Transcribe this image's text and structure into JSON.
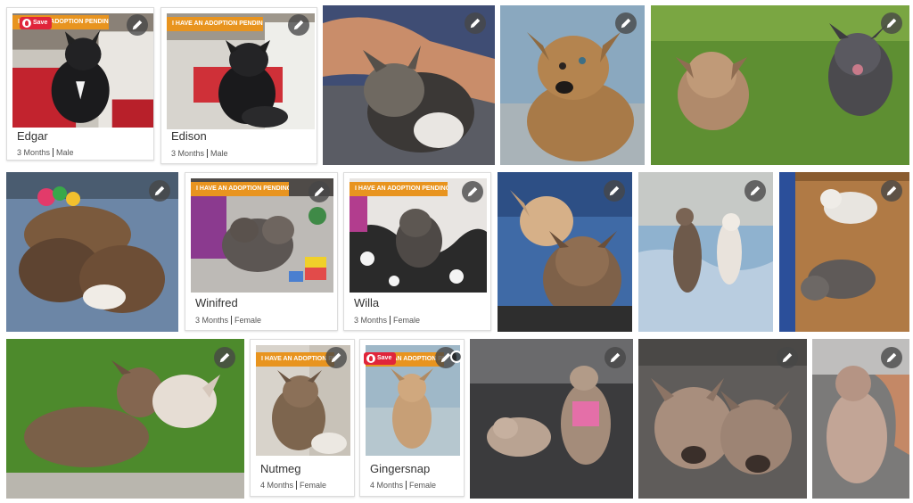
{
  "cards": [
    {
      "id": "edgar",
      "name": "Edgar",
      "age": "3 Months",
      "sex": "Male",
      "ribbon": "I HAVE AN ADOPTION PENDING"
    },
    {
      "id": "edison",
      "name": "Edison",
      "age": "3 Months",
      "sex": "Male",
      "ribbon": "I HAVE AN ADOPTION PENDING"
    },
    {
      "id": "winifred",
      "name": "Winifred",
      "age": "3 Months",
      "sex": "Female",
      "ribbon": "I HAVE AN ADOPTION PENDING"
    },
    {
      "id": "willa",
      "name": "Willa",
      "age": "3 Months",
      "sex": "Female",
      "ribbon": "I HAVE AN ADOPTION PENDING"
    },
    {
      "id": "nutmeg",
      "name": "Nutmeg",
      "age": "4 Months",
      "sex": "Female",
      "ribbon": "I HAVE AN ADOPTION PENDING"
    },
    {
      "id": "gingersnap",
      "name": "Gingersnap",
      "age": "4 Months",
      "sex": "Female",
      "ribbon": "I HAVE AN ADOPTION PENDING"
    }
  ],
  "save_label": "Save",
  "edit_icon": "pencil-icon",
  "colors": {
    "ribbon": "#e8941f",
    "save": "#e0253a",
    "edit_bg": "#464646"
  }
}
